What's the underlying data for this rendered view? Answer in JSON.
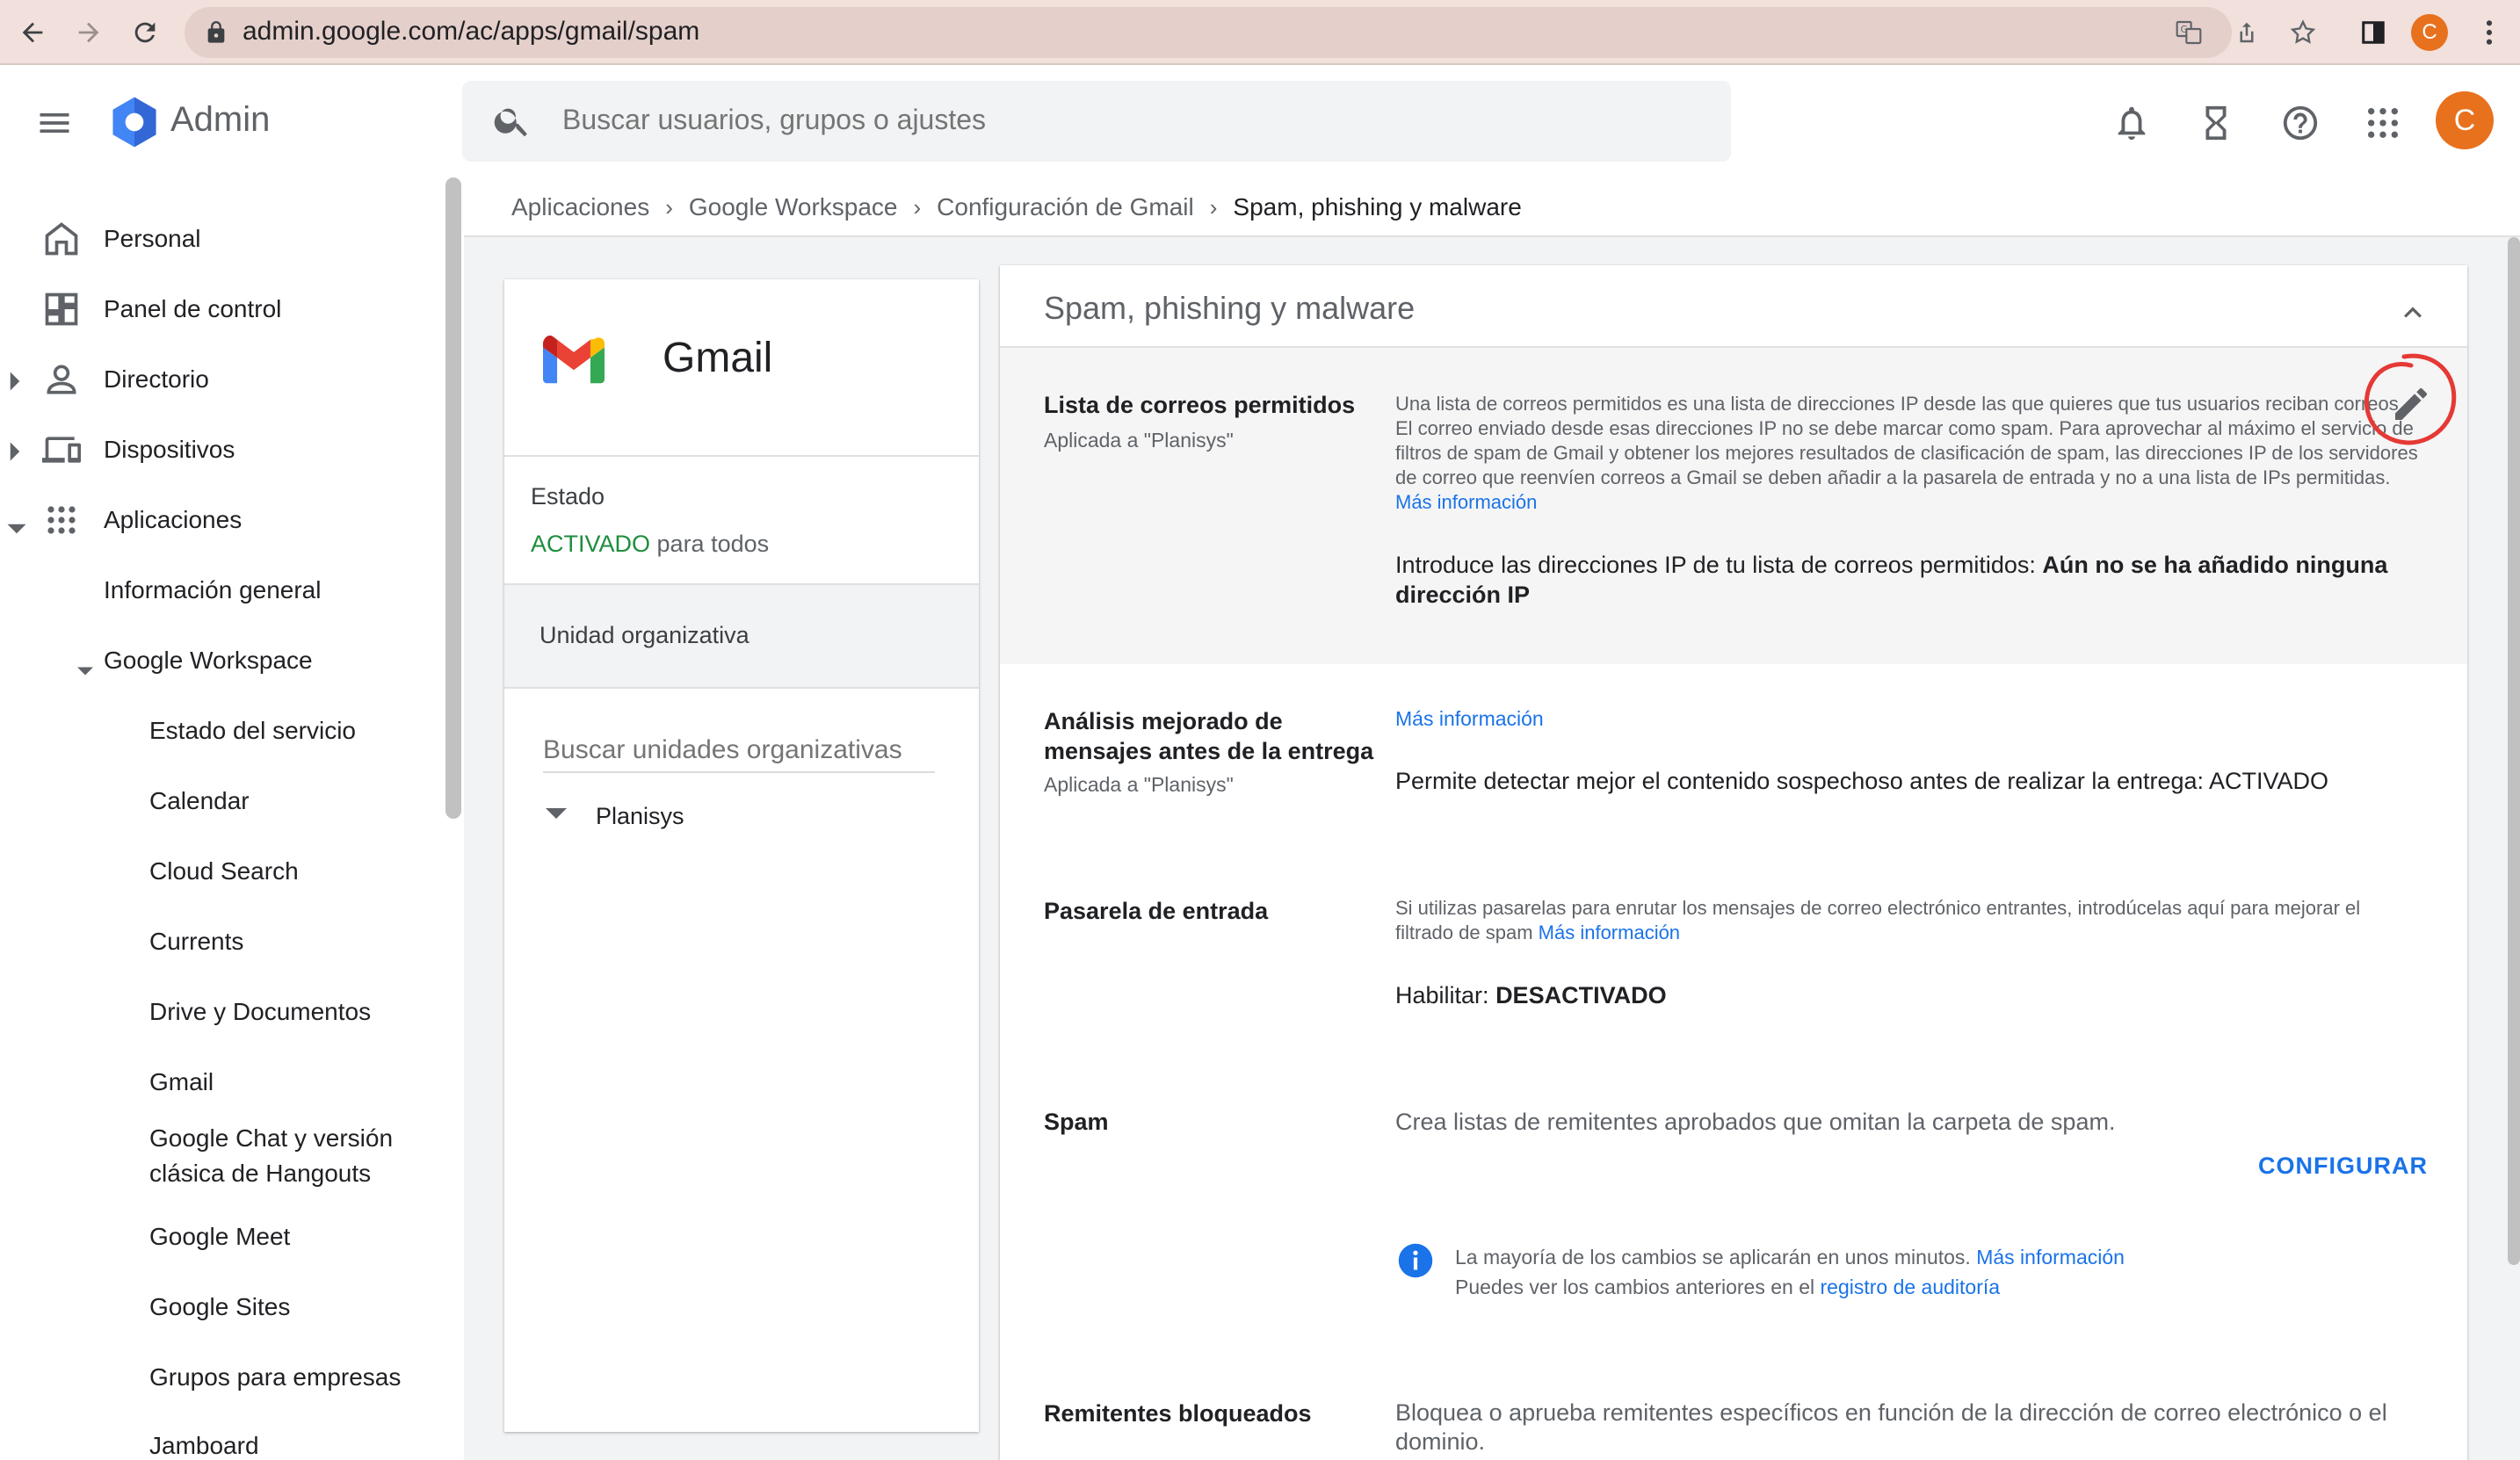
{
  "browser": {
    "url": "admin.google.com/ac/apps/gmail/spam",
    "profile_initial": "C"
  },
  "header": {
    "app_name": "Admin",
    "search_placeholder": "Buscar usuarios, grupos o ajustes",
    "avatar_initial": "C"
  },
  "sidebar": {
    "items": [
      {
        "label": "Personal"
      },
      {
        "label": "Panel de control"
      },
      {
        "label": "Directorio"
      },
      {
        "label": "Dispositivos"
      },
      {
        "label": "Aplicaciones"
      },
      {
        "label": "Información general"
      },
      {
        "label": "Google Workspace"
      },
      {
        "label": "Estado del servicio"
      },
      {
        "label": "Calendar"
      },
      {
        "label": "Cloud Search"
      },
      {
        "label": "Currents"
      },
      {
        "label": "Drive y Documentos"
      },
      {
        "label": "Gmail"
      },
      {
        "label": "Google Chat y versión"
      },
      {
        "label": "clásica de Hangouts"
      },
      {
        "label": "Google Meet"
      },
      {
        "label": "Google Sites"
      },
      {
        "label": "Grupos para empresas"
      },
      {
        "label": "Jamboard"
      }
    ]
  },
  "breadcrumb": {
    "items": [
      "Aplicaciones",
      "Google Workspace",
      "Configuración de Gmail",
      "Spam, phishing y malware"
    ]
  },
  "left_card": {
    "app_title": "Gmail",
    "status_label": "Estado",
    "status_value": "ACTIVADO",
    "status_suffix": "para todos",
    "org_unit_label": "Unidad organizativa",
    "org_search_placeholder": "Buscar unidades organizativas",
    "org_root": "Planisys"
  },
  "section": {
    "title": "Spam, phishing y malware",
    "settings": {
      "allowlist": {
        "title": "Lista de correos permitidos",
        "applied": "Aplicada a \"Planisys\"",
        "desc": "Una lista de correos permitidos es una lista de direcciones IP desde las que quieres que tus usuarios reciban correos. El correo enviado desde esas direcciones IP no se debe marcar como spam. Para aprovechar al máximo el servicio de filtros de spam de Gmail y obtener los mejores resultados de clasificación de spam, las direcciones IP de los servidores de correo que reenvíen correos a Gmail se deben añadir a la pasarela de entrada y no a una lista de IPs permitidas.",
        "more_info": "Más información",
        "value_label": "Introduce las direcciones IP de tu lista de correos permitidos:",
        "value": "Aún no se ha añadido ninguna dirección IP"
      },
      "predelivery": {
        "title_line1": "Análisis mejorado de",
        "title_line2": "mensajes antes de la entrega",
        "applied": "Aplicada a \"Planisys\"",
        "more_info": "Más información",
        "value_label": "Permite detectar mejor el contenido sospechoso antes de realizar la entrega:",
        "value": "ACTIVADO"
      },
      "gateway": {
        "title": "Pasarela de entrada",
        "desc": "Si utilizas pasarelas para enrutar los mensajes de correo electrónico entrantes, introdúcelas aquí para mejorar el filtrado de spam",
        "more_info": "Más información",
        "value_label": "Habilitar:",
        "value": "DESACTIVADO"
      },
      "spam": {
        "title": "Spam",
        "desc": "Crea listas de remitentes aprobados que omitan la carpeta de spam.",
        "configure": "CONFIGURAR",
        "info_line1": "La mayoría de los cambios se aplicarán en unos minutos.",
        "info_link1": "Más información",
        "info_line2": "Puedes ver los cambios anteriores en el",
        "info_link2": "registro de auditoría"
      },
      "blocked": {
        "title": "Remitentes bloqueados",
        "desc": "Bloquea o aprueba remitentes específicos en función de la dirección de correo electrónico o el dominio."
      }
    }
  },
  "colors": {
    "accent": "#1a73e8",
    "activated": "#1e8e3e",
    "annotation": "#e53935",
    "avatar": "#e8711e"
  }
}
